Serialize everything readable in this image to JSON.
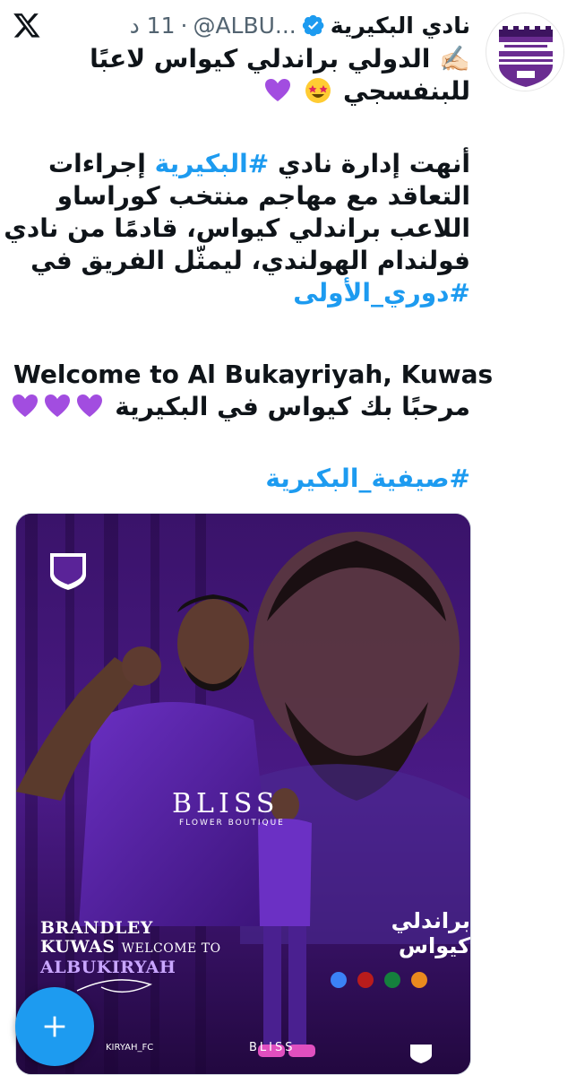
{
  "header": {
    "display_name": "نادي البكيرية",
    "handle": "@ALBU...",
    "separator": "·",
    "time": "11 د",
    "verified_icon": "verified-badge-icon"
  },
  "post": {
    "title_lines": [
      "✍🏻 الدولي براندلي كيواس لاعبًا",
      "للبنفسجي"
    ],
    "body": {
      "line1_a": "أنهت إدارة نادي ",
      "line1_tag": "#البكيرية",
      "line1_b": " إجراءات",
      "line2": "التعاقد مع مهاجم منتخب كوراساو",
      "line3": "اللاعب براندلي كيواس، قادمًا من نادي",
      "line4": "فولندام الهولندي، ليمثّل الفريق في",
      "line5_tag": "#دوري_الأولى"
    },
    "welcome_en": "Welcome to Al Bukayriyah, Kuwas",
    "welcome_ar": "مرحبًا بك كيواس في البكيرية",
    "hashtag": "#صيفية_البكيرية"
  },
  "media": {
    "name_line1": "BRANDLEY",
    "name_line2": "KUWAS",
    "welcome_to": "WELCOME TO",
    "club": "ALBUKIRYAH",
    "arabic_name": "براندلي كيواس",
    "sponsor": "BLISS",
    "sponsor_sub": "FLOWER BOUTIQUE",
    "social": "KIRYAH_FC",
    "sponsor_footer": "BLISS"
  },
  "icons": {
    "x_logo": "x-logo-icon",
    "compose": "plus-icon",
    "heart": "purple-heart-icon",
    "star_eyes": "star-struck-emoji-icon"
  },
  "colors": {
    "accent": "#1d9bf0",
    "purple": "#8a2be2",
    "text": "#0f1419",
    "secondary": "#536471"
  }
}
